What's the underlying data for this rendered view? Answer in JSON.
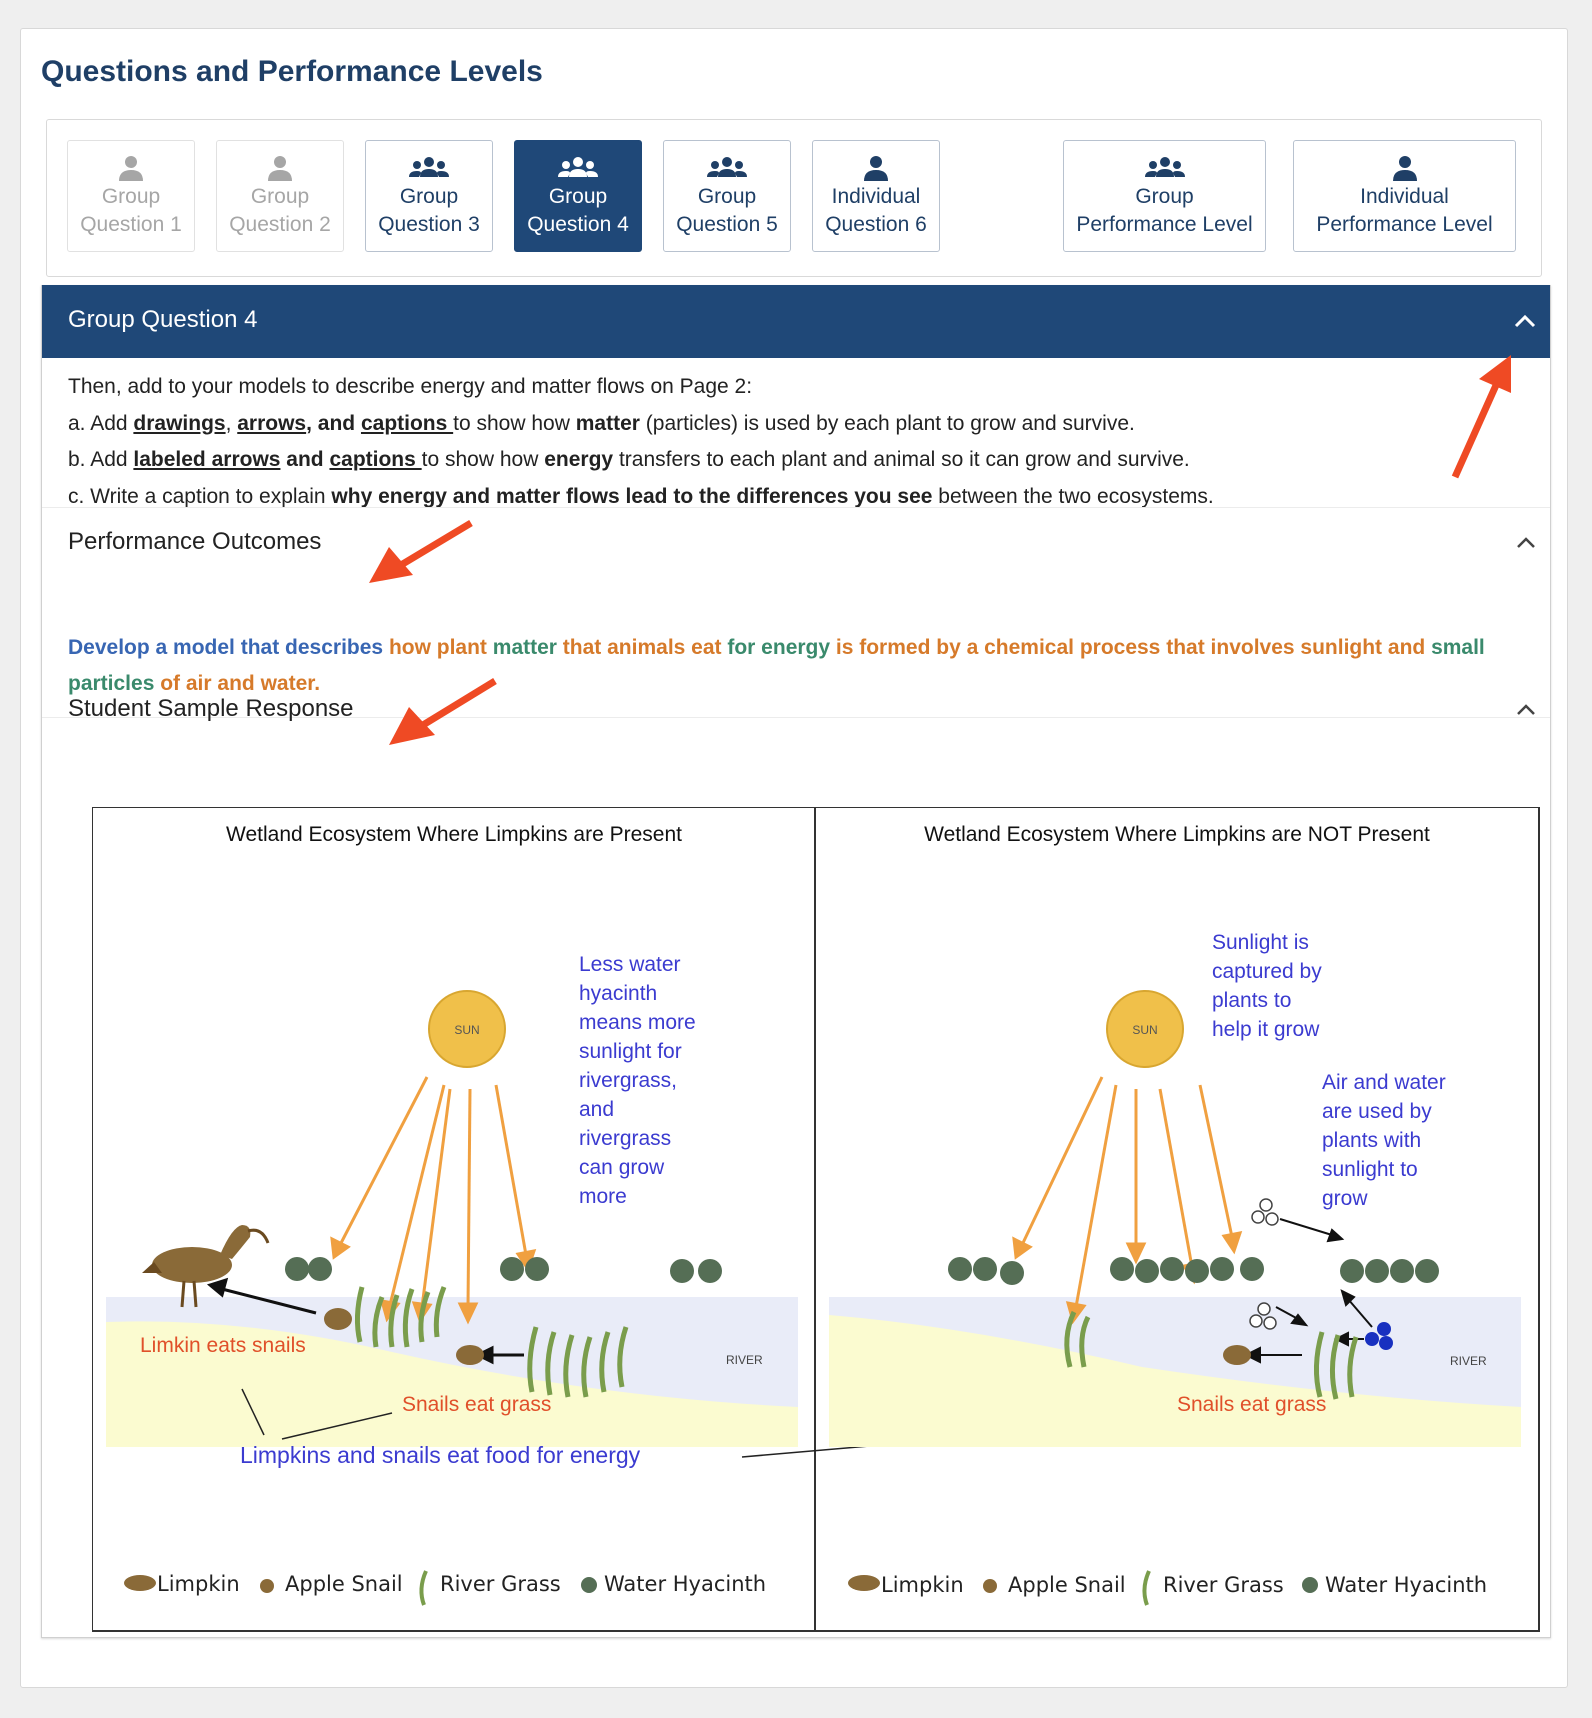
{
  "page": {
    "title": "Questions and Performance Levels"
  },
  "tabs": [
    {
      "line1": "Group",
      "line2": "Question 1",
      "icon": "person-icon",
      "state": "disabled"
    },
    {
      "line1": "Group",
      "line2": "Question 2",
      "icon": "person-icon",
      "state": "disabled"
    },
    {
      "line1": "Group",
      "line2": "Question 3",
      "icon": "group-icon",
      "state": "enabled"
    },
    {
      "line1": "Group",
      "line2": "Question 4",
      "icon": "group-icon",
      "state": "active"
    },
    {
      "line1": "Group",
      "line2": "Question 5",
      "icon": "group-icon",
      "state": "enabled"
    },
    {
      "line1": "Individual",
      "line2": "Question 6",
      "icon": "person-icon",
      "state": "enabled"
    },
    {
      "line1": "Group",
      "line2": "Performance Level",
      "icon": "group-icon",
      "state": "enabled"
    },
    {
      "line1": "Individual",
      "line2": "Performance Level",
      "icon": "person-icon",
      "state": "enabled"
    }
  ],
  "panel": {
    "title": "Group Question 4",
    "question": {
      "intro": "Then, add to your models to describe energy and matter flows on Page 2:",
      "a_prefix": "a. Add ",
      "a_u1": "drawings",
      "a_sep1": ", ",
      "a_u2": "arrows",
      "a_sep2": ", and ",
      "a_u3": "captions ",
      "a_mid": "to show how ",
      "a_bold": "matter",
      "a_end": " (particles) is used by each plant to grow and survive.",
      "b_prefix": "b. Add ",
      "b_u1": "labeled arrows",
      "b_sep": " and ",
      "b_u2": "captions ",
      "b_mid": "to show how ",
      "b_bold": "energy",
      "b_end": " transfers to each plant and animal so it can grow and survive.",
      "c_prefix": "c. Write a caption to explain ",
      "c_bold": "why energy and matter flows lead to the differences you see",
      "c_end": " between the two ecosystems."
    },
    "outcomes": {
      "title": "Performance Outcomes",
      "parts": [
        {
          "text": "Develop a model that describes ",
          "color": "#3866b3"
        },
        {
          "text": "how plant ",
          "color": "#d67a2a"
        },
        {
          "text": "matter ",
          "color": "#3a8a6c"
        },
        {
          "text": "that animals eat ",
          "color": "#d67a2a"
        },
        {
          "text": "for energy ",
          "color": "#3a8a6c"
        },
        {
          "text": "is formed by a chemical process that involves sunlight and ",
          "color": "#d67a2a"
        },
        {
          "text": "small particles ",
          "color": "#3a8a6c"
        },
        {
          "text": "of air and water.",
          "color": "#d67a2a"
        }
      ]
    },
    "sample": {
      "title": "Student Sample Response",
      "left_title": "Wetland Ecosystem Where Limpkins are Present",
      "right_title": "Wetland Ecosystem Where Limpkins are NOT Present",
      "sun": "SUN",
      "river": "RIVER",
      "left_note": [
        "Less water",
        "hyacinth",
        "means more",
        "sunlight for",
        "rivergrass,",
        "and",
        "rivergrass",
        "can grow",
        "more"
      ],
      "right_note1": [
        "Sunlight is",
        "captured by",
        "plants to",
        "help it grow"
      ],
      "right_note2": [
        "Air and water",
        "are used by",
        "plants with",
        "sunlight to",
        "grow"
      ],
      "limpkin_caption": "Limkin eats snails",
      "snails_caption": "Snails eat grass",
      "shared_caption": "Limpkins and snails eat food for energy",
      "legend": [
        "Limpkin",
        "Apple Snail",
        "River Grass",
        "Water Hyacinth"
      ]
    }
  },
  "colors": {
    "navy": "#1f4878",
    "title": "#1f3f66",
    "arrow_red": "#ef4a24",
    "sun": "#f0c04a",
    "ray": "#f0a040",
    "note_blue": "#3b3bd0",
    "note_red": "#e0502a"
  }
}
